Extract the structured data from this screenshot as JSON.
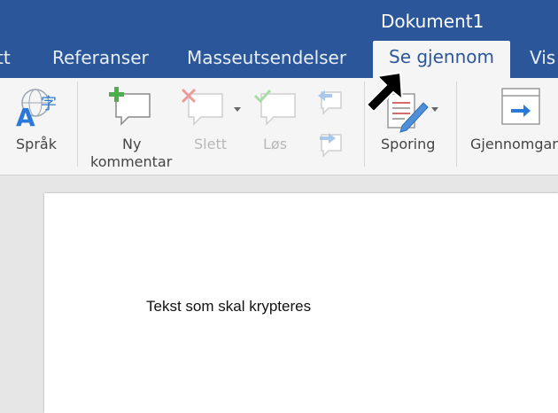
{
  "window": {
    "title": "Dokument1"
  },
  "tabs": [
    {
      "label": "tt",
      "active": false
    },
    {
      "label": "Referanser",
      "active": false
    },
    {
      "label": "Masseutsendelser",
      "active": false
    },
    {
      "label": "Se gjennom",
      "active": true
    },
    {
      "label": "Vis",
      "active": false
    }
  ],
  "ribbon": {
    "language": {
      "label": "Språk",
      "icon": "language-icon"
    },
    "new_comment": {
      "line1": "Ny",
      "line2": "kommentar",
      "icon": "new-comment-icon"
    },
    "delete": {
      "label": "Slett",
      "icon": "delete-comment-icon",
      "enabled": false
    },
    "resolve": {
      "label": "Løs",
      "icon": "resolve-comment-icon",
      "enabled": false
    },
    "previous": {
      "icon": "previous-comment-icon",
      "enabled": false
    },
    "next": {
      "icon": "next-comment-icon",
      "enabled": false
    },
    "tracking": {
      "label": "Sporing",
      "icon": "track-changes-icon"
    },
    "review_pane": {
      "label": "Gjennomgan",
      "icon": "review-pane-icon"
    }
  },
  "document": {
    "text": "Tekst som skal krypteres"
  },
  "colors": {
    "title_bar": "#2b579a",
    "ribbon": "#f5f5f5",
    "accent_green": "#5cb85c",
    "accent_red": "#e05050"
  }
}
